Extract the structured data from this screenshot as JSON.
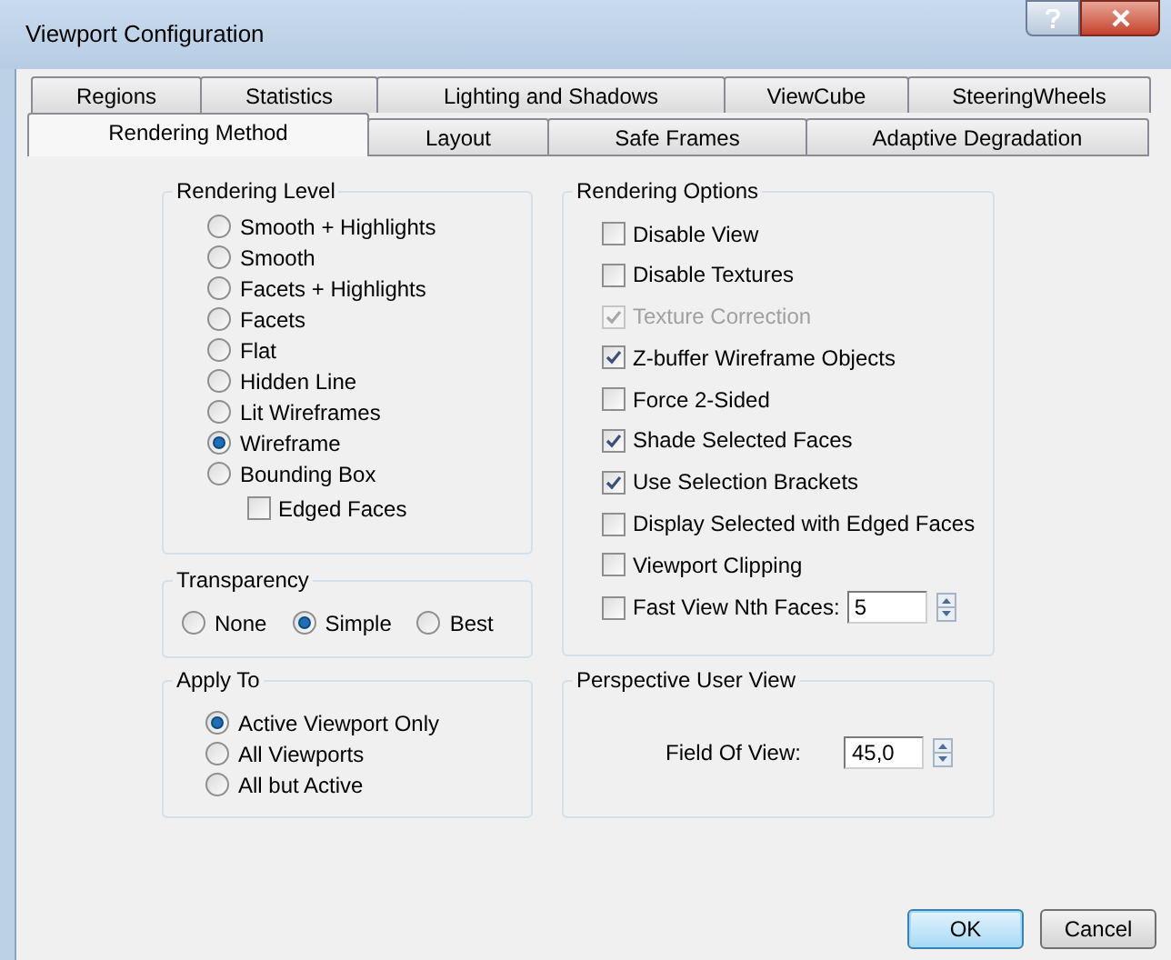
{
  "window": {
    "title": "Viewport Configuration"
  },
  "tab_rows": [
    [
      {
        "label": "Regions",
        "selected": false
      },
      {
        "label": "Statistics",
        "selected": false
      },
      {
        "label": "Lighting and Shadows",
        "selected": false
      },
      {
        "label": "ViewCube",
        "selected": false
      },
      {
        "label": "SteeringWheels",
        "selected": false
      }
    ],
    [
      {
        "label": "Rendering Method",
        "selected": true
      },
      {
        "label": "Layout",
        "selected": false
      },
      {
        "label": "Safe Frames",
        "selected": false
      },
      {
        "label": "Adaptive Degradation",
        "selected": false
      }
    ]
  ],
  "rendering_level": {
    "title": "Rendering Level",
    "options": [
      {
        "label": "Smooth + Highlights",
        "selected": false
      },
      {
        "label": "Smooth",
        "selected": false
      },
      {
        "label": "Facets + Highlights",
        "selected": false
      },
      {
        "label": "Facets",
        "selected": false
      },
      {
        "label": "Flat",
        "selected": false
      },
      {
        "label": "Hidden Line",
        "selected": false
      },
      {
        "label": "Lit Wireframes",
        "selected": false
      },
      {
        "label": "Wireframe",
        "selected": true
      },
      {
        "label": "Bounding Box",
        "selected": false
      }
    ],
    "edged_faces": {
      "label": "Edged Faces",
      "checked": false
    }
  },
  "transparency": {
    "title": "Transparency",
    "options": [
      {
        "label": "None",
        "selected": false
      },
      {
        "label": "Simple",
        "selected": true
      },
      {
        "label": "Best",
        "selected": false
      }
    ]
  },
  "apply_to": {
    "title": "Apply To",
    "options": [
      {
        "label": "Active Viewport Only",
        "selected": true
      },
      {
        "label": "All Viewports",
        "selected": false
      },
      {
        "label": "All but Active",
        "selected": false
      }
    ]
  },
  "rendering_options": {
    "title": "Rendering Options",
    "items": [
      {
        "kind": "checkbox",
        "label": "Disable View",
        "checked": false,
        "disabled": false
      },
      {
        "kind": "checkbox",
        "label": "Disable Textures",
        "checked": false,
        "disabled": false
      },
      {
        "kind": "checkbox",
        "label": "Texture Correction",
        "checked": true,
        "disabled": true
      },
      {
        "kind": "checkbox",
        "label": "Z-buffer Wireframe Objects",
        "checked": true,
        "disabled": false
      },
      {
        "kind": "checkbox",
        "label": "Force 2-Sided",
        "checked": false,
        "disabled": false
      },
      {
        "kind": "checkbox",
        "label": "Shade Selected Faces",
        "checked": true,
        "disabled": false
      },
      {
        "kind": "checkbox",
        "label": "Use Selection Brackets",
        "checked": true,
        "disabled": false
      },
      {
        "kind": "checkbox",
        "label": "Display Selected with Edged Faces",
        "checked": false,
        "disabled": false
      },
      {
        "kind": "checkbox",
        "label": "Viewport Clipping",
        "checked": false,
        "disabled": false
      },
      {
        "kind": "spinner",
        "label": "Fast View Nth Faces:",
        "checked": false,
        "disabled": false,
        "value": "5"
      }
    ]
  },
  "perspective": {
    "title": "Perspective User View",
    "field_label": "Field Of View:",
    "value": "45,0"
  },
  "buttons": [
    {
      "label": "OK",
      "primary": true
    },
    {
      "label": "Cancel",
      "primary": false
    }
  ]
}
